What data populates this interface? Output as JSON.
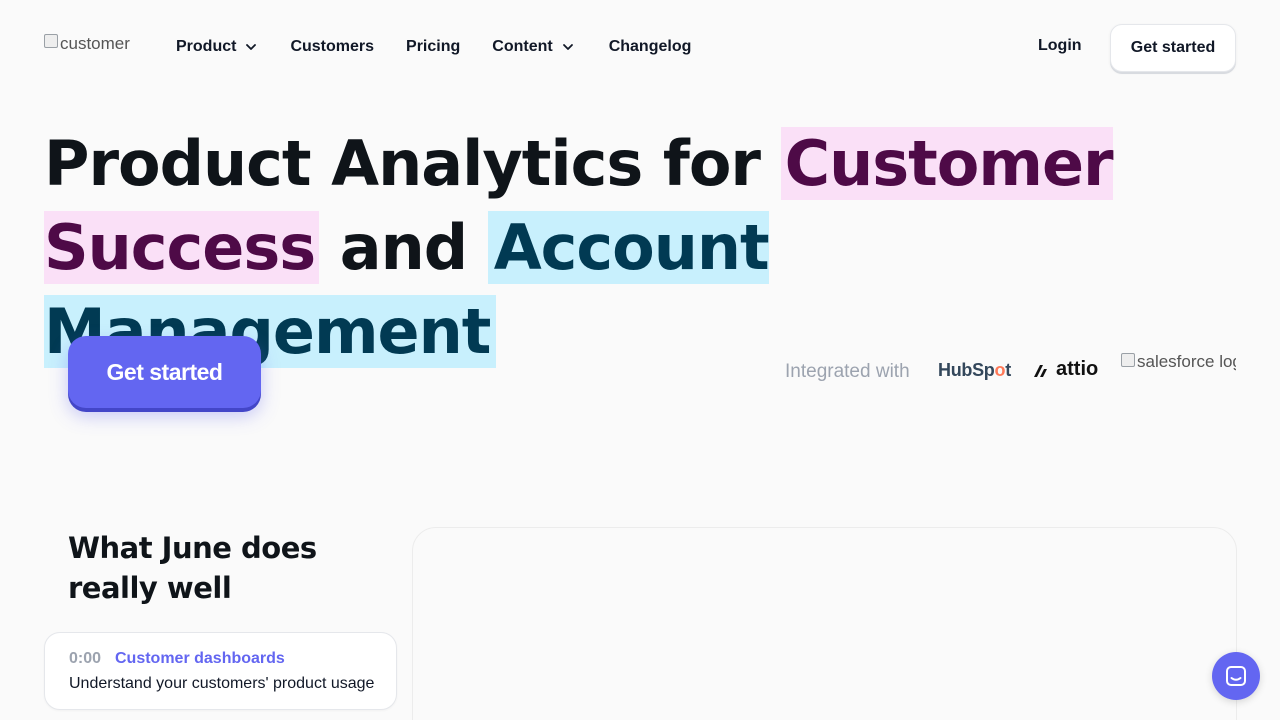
{
  "nav": {
    "logo_alt": "customer",
    "links": [
      {
        "label": "Product",
        "has_dropdown": true
      },
      {
        "label": "Customers",
        "has_dropdown": false
      },
      {
        "label": "Pricing",
        "has_dropdown": false
      },
      {
        "label": "Content",
        "has_dropdown": true
      },
      {
        "label": "Changelog",
        "has_dropdown": false
      }
    ],
    "login_label": "Login",
    "cta_label": "Get started"
  },
  "hero": {
    "title_part1": "Product Analytics for ",
    "title_highlight1": "Customer Success",
    "title_part2": " and ",
    "title_highlight2": "Account Management",
    "cta_label": "Get started",
    "integrated_label": "Integrated with",
    "integrations": {
      "hubspot_prefix": "HubSp",
      "hubspot_spot": "o",
      "hubspot_suffix": "t",
      "attio": "attio",
      "salesforce_alt": "salesforce log"
    }
  },
  "features": {
    "title": "What June does really well",
    "items": [
      {
        "time": "0:00",
        "title": "Customer dashboards",
        "description": "Understand your customers' product usage"
      }
    ]
  },
  "colors": {
    "accent": "#6366f1",
    "highlight_pink_bg": "#fae0f7",
    "highlight_pink_text": "#4e0a47",
    "highlight_cyan_bg": "#c8f0fd",
    "highlight_cyan_text": "#013a53"
  },
  "icons": {
    "dropdown": "chevron-down-icon",
    "chat": "chat-icon"
  }
}
